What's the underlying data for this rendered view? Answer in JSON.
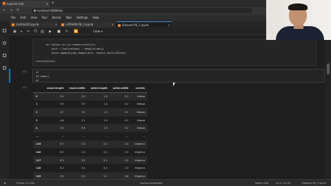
{
  "browser": {
    "tab_title": "Lupa ke Lab",
    "url": "localhost:8888/lab"
  },
  "menu": [
    "File",
    "Edit",
    "View",
    "Run",
    "Kernel",
    "Tabs",
    "Settings",
    "Help"
  ],
  "doc_tabs": [
    {
      "label": "Untitled23.ipynb"
    },
    {
      "label": "LATIHAN P8_2.ipynb"
    },
    {
      "label": "Dataset P8_1.ipynb"
    }
  ],
  "toolbar": {
    "cell_type": "Code",
    "kernel": "Python 3"
  },
  "code_cell": {
    "lines": [
      "for values in csv.reader(csvfile):",
      "    dict = {val[values] : temp[values]}",
      "    dicts.append(json.dumps(dict, ensure_ascii=False))",
      "",
      "return(dicts)"
    ]
  },
  "active_cell": {
    "prompt": "[6]:",
    "lines": [
      "df",
      "df.head()",
      "df"
    ]
  },
  "output_prompt": "[6]:",
  "table": {
    "columns": [
      "",
      "sepal.length",
      "sepal.width",
      "petal.length",
      "petal.width",
      "variety"
    ],
    "rows": [
      [
        "0",
        "5.1",
        "3.5",
        "1.4",
        "0.2",
        "Setosa"
      ],
      [
        "1",
        "4.9",
        "3.0",
        "1.4",
        "0.2",
        "Setosa"
      ],
      [
        "2",
        "4.7",
        "3.2",
        "1.3",
        "0.2",
        "Setosa"
      ],
      [
        "3",
        "4.6",
        "3.1",
        "1.5",
        "0.2",
        "Setosa"
      ],
      [
        "4",
        "5.0",
        "3.6",
        "1.4",
        "0.2",
        "Setosa"
      ],
      [
        "...",
        "...",
        "...",
        "...",
        "...",
        "..."
      ],
      [
        "145",
        "6.7",
        "3.0",
        "5.2",
        "2.3",
        "Virginica"
      ],
      [
        "146",
        "6.3",
        "2.5",
        "5.0",
        "1.9",
        "Virginica"
      ],
      [
        "147",
        "6.5",
        "3.0",
        "5.2",
        "2.0",
        "Virginica"
      ],
      [
        "148",
        "6.2",
        "3.4",
        "5.4",
        "2.3",
        "Virginica"
      ],
      [
        "149",
        "5.9",
        "3.0",
        "5.1",
        "1.8",
        "Virginica"
      ]
    ]
  },
  "status": {
    "left": "Python 3 | Idle",
    "center": "Saving completed",
    "mode": "Mode: Edit",
    "position": "Ln 6, Col 24",
    "file": "Dataset P8_1.ipynb"
  },
  "colors": {
    "accent": "#1976d2",
    "jupyter_orange": "#f37726"
  }
}
